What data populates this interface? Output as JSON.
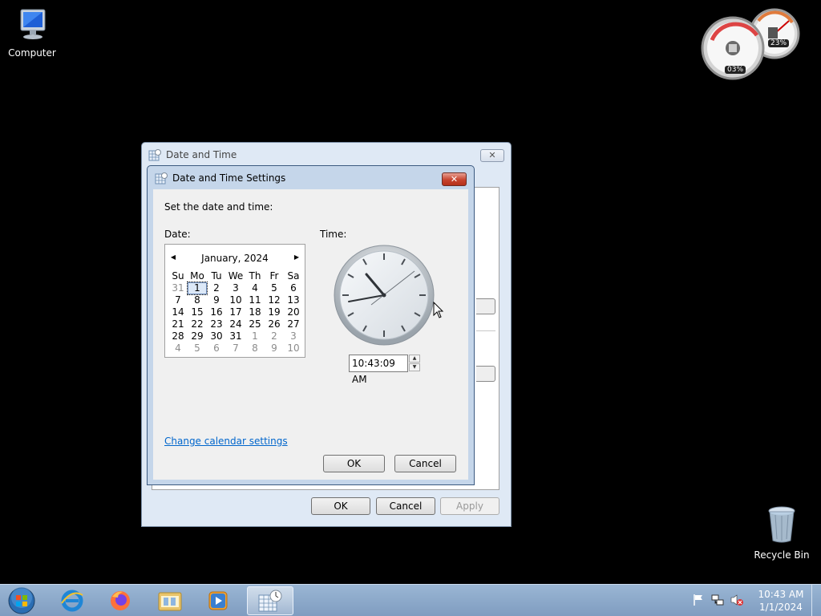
{
  "desktop": {
    "computer_label": "Computer",
    "recycle_label": "Recycle Bin",
    "gadget": {
      "cpu": "03%",
      "memory": "23%"
    }
  },
  "outer_window": {
    "title": "Date and Time",
    "close_symbol": "✕",
    "ok_label": "OK",
    "cancel_label": "Cancel",
    "apply_label": "Apply"
  },
  "dialog": {
    "title": "Date and Time Settings",
    "close_symbol": "✕",
    "instruction": "Set the date and time:",
    "date_label": "Date:",
    "time_label": "Time:",
    "calendar": {
      "month_label": "January, 2024",
      "prev_symbol": "◀",
      "next_symbol": "▶",
      "weekdays": [
        "Su",
        "Mo",
        "Tu",
        "We",
        "Th",
        "Fr",
        "Sa"
      ],
      "weeks": [
        [
          "31",
          "1",
          "2",
          "3",
          "4",
          "5",
          "6"
        ],
        [
          "7",
          "8",
          "9",
          "10",
          "11",
          "12",
          "13"
        ],
        [
          "14",
          "15",
          "16",
          "17",
          "18",
          "19",
          "20"
        ],
        [
          "21",
          "22",
          "23",
          "24",
          "25",
          "26",
          "27"
        ],
        [
          "28",
          "29",
          "30",
          "31",
          "1",
          "2",
          "3"
        ],
        [
          "4",
          "5",
          "6",
          "7",
          "8",
          "9",
          "10"
        ]
      ],
      "selected_day": "1"
    },
    "time_value": "10:43:09 AM",
    "spin_up": "▲",
    "spin_down": "▼",
    "change_calendar_link": "Change calendar settings",
    "ok_label": "OK",
    "cancel_label": "Cancel"
  },
  "taskbar": {
    "time": "10:43 AM",
    "date": "1/1/2024",
    "items": [
      "internet-explorer",
      "firefox",
      "file-explorer",
      "media-player",
      "date-time-control-panel"
    ]
  },
  "colors": {
    "accent_link": "#0066cc",
    "close_red": "#c7432e",
    "taskbar": "#8fabcc"
  }
}
